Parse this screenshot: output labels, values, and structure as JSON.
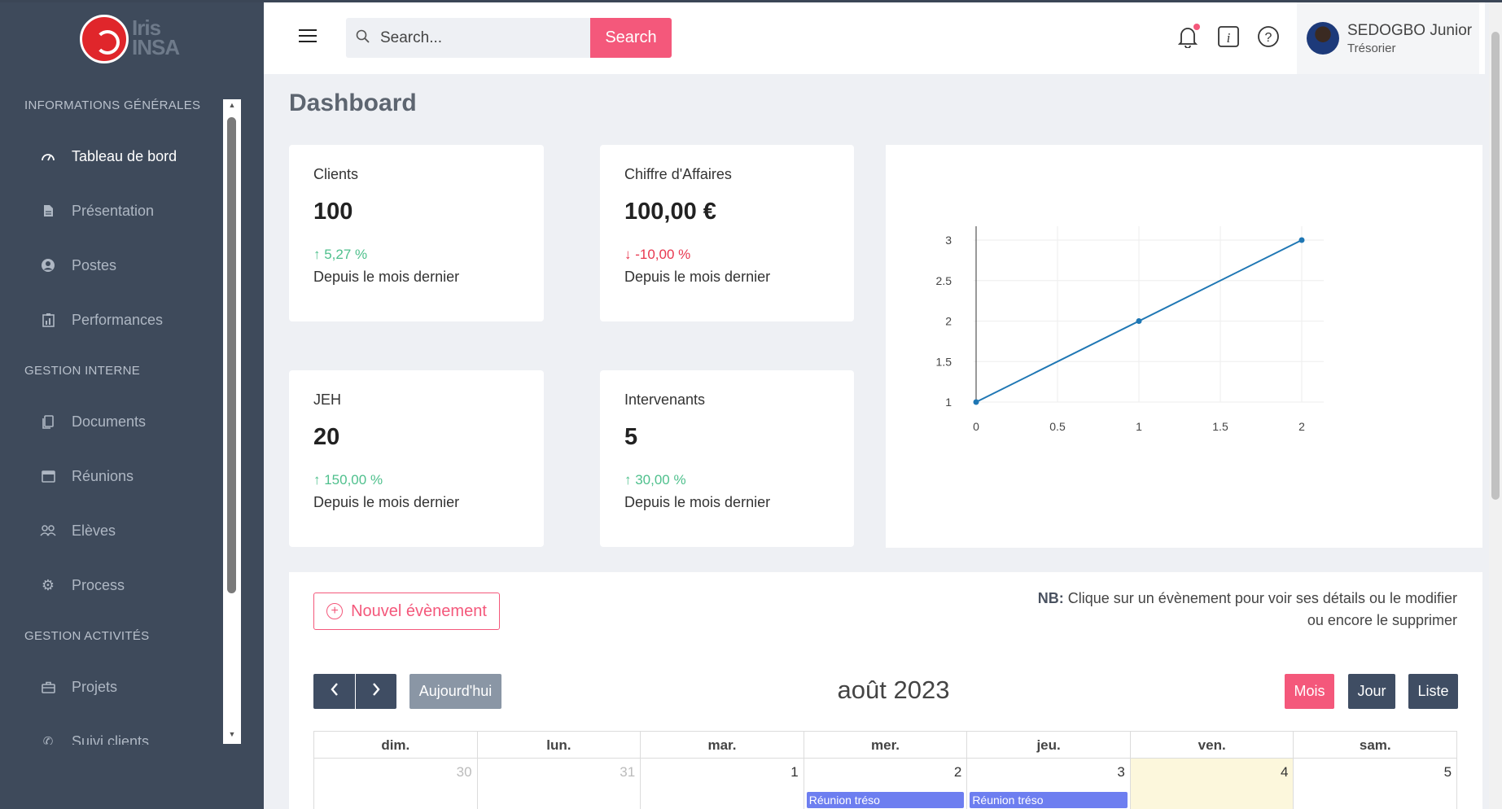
{
  "app": {
    "logo_text": "Iris INSA"
  },
  "sidebar": {
    "sections": [
      {
        "label": "INFORMATIONS GÉNÉRALES"
      },
      {
        "label": "GESTION INTERNE"
      },
      {
        "label": "GESTION ACTIVITÉS"
      }
    ],
    "items": [
      {
        "label": "Tableau de bord",
        "icon": "gauge-icon"
      },
      {
        "label": "Présentation",
        "icon": "file-icon"
      },
      {
        "label": "Postes",
        "icon": "user-circle-icon"
      },
      {
        "label": "Performances",
        "icon": "report-icon"
      },
      {
        "label": "Documents",
        "icon": "copy-icon"
      },
      {
        "label": "Réunions",
        "icon": "calendar-icon"
      },
      {
        "label": "Elèves",
        "icon": "users-icon"
      },
      {
        "label": "Process",
        "icon": "gear-icon"
      },
      {
        "label": "Projets",
        "icon": "briefcase-icon"
      },
      {
        "label": "Suivi clients",
        "icon": "phone-icon"
      }
    ]
  },
  "topbar": {
    "search_placeholder": "Search...",
    "search_button": "Search",
    "user_name": "SEDOGBO Junior",
    "user_role": "Trésorier"
  },
  "page": {
    "title": "Dashboard"
  },
  "stats": [
    {
      "label": "Clients",
      "value": "100",
      "change": "↑ 5,27 %",
      "direction": "up",
      "since": "Depuis le mois dernier"
    },
    {
      "label": "Chiffre d'Affaires",
      "value": "100,00 €",
      "change": "↓ -10,00 %",
      "direction": "down",
      "since": "Depuis le mois dernier"
    },
    {
      "label": "JEH",
      "value": "20",
      "change": "↑ 150,00 %",
      "direction": "up",
      "since": "Depuis le mois dernier"
    },
    {
      "label": "Intervenants",
      "value": "5",
      "change": "↑ 30,00 %",
      "direction": "up",
      "since": "Depuis le mois dernier"
    }
  ],
  "chart_data": {
    "type": "line",
    "x": [
      0,
      1,
      2
    ],
    "y": [
      1,
      2,
      3
    ],
    "xlim": [
      0,
      2
    ],
    "ylim": [
      1,
      3
    ],
    "xticks": [
      "0",
      "0.5",
      "1",
      "1.5",
      "2"
    ],
    "yticks": [
      "1",
      "1.5",
      "2",
      "2.5",
      "3"
    ],
    "color": "#1f77b4",
    "grid": true
  },
  "calendar": {
    "new_event_label": "Nouvel évènement",
    "note_bold": "NB:",
    "note_text": "Clique sur un évènement pour voir ses détails ou le modifier ou encore le supprimer",
    "today_label": "Aujourd'hui",
    "month_title": "août 2023",
    "views": [
      "Mois",
      "Jour",
      "Liste"
    ],
    "weekdays": [
      "dim.",
      "lun.",
      "mar.",
      "mer.",
      "jeu.",
      "ven.",
      "sam."
    ],
    "first_week": [
      {
        "day": "30",
        "other": true
      },
      {
        "day": "31",
        "other": true
      },
      {
        "day": "1"
      },
      {
        "day": "2",
        "event": "Réunion tréso"
      },
      {
        "day": "3",
        "event": "Réunion tréso"
      },
      {
        "day": "4",
        "today": true
      },
      {
        "day": "5"
      }
    ]
  },
  "colors": {
    "accent": "#f4587b",
    "sidebar": "#3e4a5b",
    "nav_button": "#3f4d63",
    "event": "#6d7ef0"
  }
}
